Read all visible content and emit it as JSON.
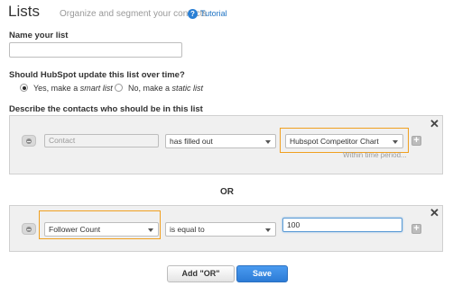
{
  "header": {
    "title": "Lists",
    "subtitle": "Organize and segment your contacts",
    "tutorial_icon": "?",
    "tutorial_label": "Tutorial"
  },
  "name_field": {
    "label": "Name your list",
    "value": ""
  },
  "update_question": {
    "label": "Should HubSpot update this list over time?",
    "options": [
      {
        "prefix": "Yes, make a ",
        "emphasis": "smart list",
        "checked": true
      },
      {
        "prefix": "No, make a ",
        "emphasis": "static list",
        "checked": false
      }
    ]
  },
  "describe_label": "Describe the contacts who should be in this list",
  "filter_groups": [
    {
      "property": "Contact",
      "operator": "has filled out",
      "value": "Hubspot Competitor Chart",
      "hint": "Within time period..."
    },
    {
      "property": "Follower Count",
      "operator": "is equal to",
      "value": "100"
    }
  ],
  "or_label": "OR",
  "buttons": {
    "add_or": "Add \"OR\"",
    "save": "Save"
  },
  "icons": {
    "close": "close-icon",
    "remove": "remove-filter-icon",
    "add": "add-filter-icon",
    "dropdown": "chevron-down-icon"
  },
  "colors": {
    "highlight": "#f0a020",
    "link": "#1f73c3",
    "save_button": "#2c7bd6"
  }
}
